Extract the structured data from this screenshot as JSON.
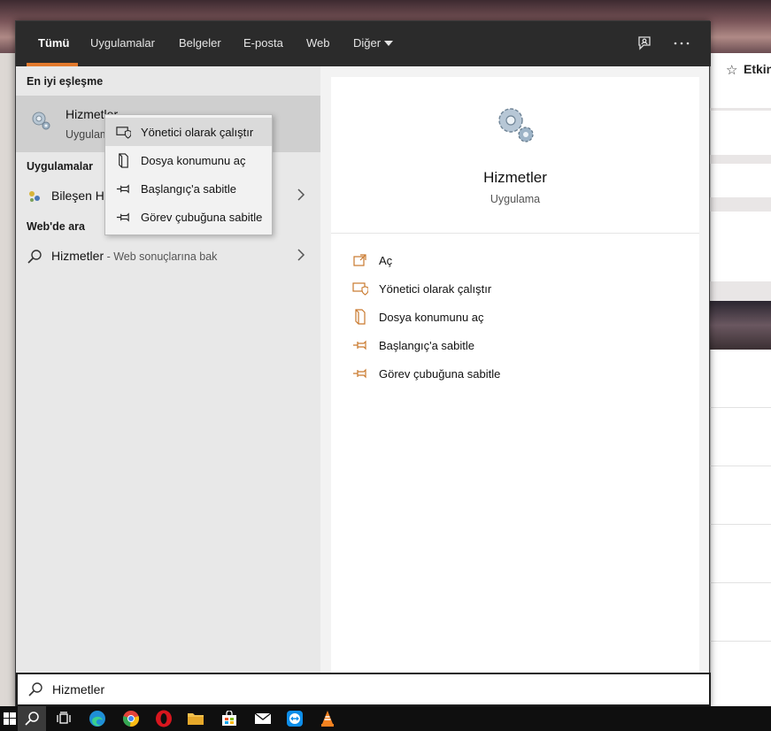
{
  "tabs": [
    {
      "label": "Tümü",
      "active": true
    },
    {
      "label": "Uygulamalar"
    },
    {
      "label": "Belgeler"
    },
    {
      "label": "E-posta"
    },
    {
      "label": "Web"
    },
    {
      "label": "Diğer"
    }
  ],
  "toolbar_icons": [
    "feedback-icon",
    "more-icon"
  ],
  "background_page": {
    "label": "Etkin"
  },
  "left": {
    "best_match_header": "En iyi eşleşme",
    "best_match": {
      "name": "Hizmetler",
      "type": "Uygulama"
    },
    "apps_header": "Uygulamalar",
    "app_result": {
      "name": "Bileşen Hizmetleri"
    },
    "web_header": "Web'de ara",
    "web_result": {
      "query": "Hizmetler",
      "hint": " - Web sonuçlarına bak"
    }
  },
  "context_menu": [
    {
      "label": "Yönetici olarak çalıştır",
      "icon": "shield-window-icon"
    },
    {
      "label": "Dosya konumunu aç",
      "icon": "folder-location-icon"
    },
    {
      "label": "Başlangıç'a sabitle",
      "icon": "pin-icon"
    },
    {
      "label": "Görev çubuğuna sabitle",
      "icon": "pin-icon"
    }
  ],
  "preview": {
    "title": "Hizmetler",
    "subtitle": "Uygulama",
    "actions": [
      {
        "label": "Aç",
        "icon": "open-icon"
      },
      {
        "label": "Yönetici olarak çalıştır",
        "icon": "shield-window-icon"
      },
      {
        "label": "Dosya konumunu aç",
        "icon": "folder-location-icon"
      },
      {
        "label": "Başlangıç'a sabitle",
        "icon": "pin-icon"
      },
      {
        "label": "Görev çubuğuna sabitle",
        "icon": "pin-icon"
      }
    ]
  },
  "search": {
    "value": "Hizmetler"
  },
  "taskbar": [
    "windows-start-icon",
    "search-icon",
    "task-view-icon",
    "edge-icon",
    "chrome-icon",
    "opera-icon",
    "file-explorer-icon",
    "store-icon",
    "mail-icon",
    "teamviewer-icon",
    "vlc-icon"
  ],
  "colors": {
    "accent": "#e3792c",
    "tabbar": "#2b2b2b",
    "action_icon": "#c9792d"
  }
}
